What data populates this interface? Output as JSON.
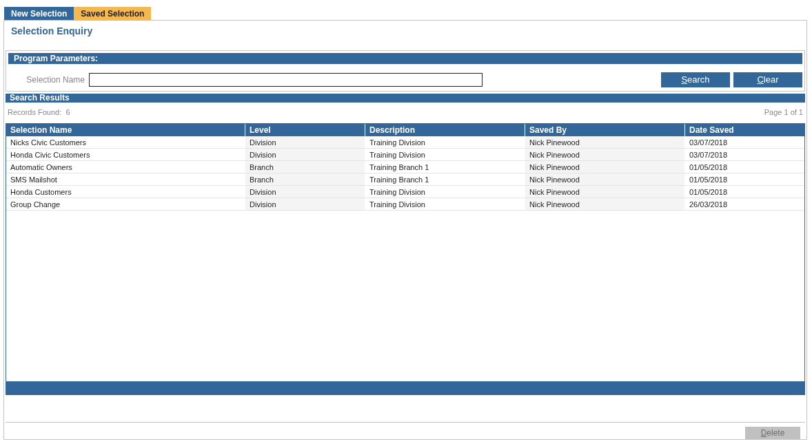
{
  "tabs": [
    {
      "label": "New Selection",
      "selected": false
    },
    {
      "label": "Saved Selection",
      "selected": true
    }
  ],
  "title": "Selection Enquiry",
  "parameters": {
    "heading": "Program Parameters:",
    "field_label": "Selection Name",
    "buttons": [
      {
        "label": "Search",
        "disabled": false
      },
      {
        "label": "Clear",
        "disabled": false
      }
    ]
  },
  "results": {
    "heading": "Search Results",
    "records_label": "Records Found:",
    "records_count": "6",
    "page": "Page 1 of 1"
  },
  "table": {
    "columns": [
      "Selection Name",
      "Level",
      "Description",
      "Saved By",
      "Date Saved"
    ],
    "rows": [
      [
        "Nicks Civic Customers",
        "Division",
        "Training Division",
        "Nick Pinewood",
        "03/07/2018"
      ],
      [
        "Honda Civic Customers",
        "Division",
        "Training Division",
        "Nick Pinewood",
        "03/07/2018"
      ],
      [
        "Automatic Owners",
        "Branch",
        "Training Branch 1",
        "Nick Pinewood",
        "01/05/2018"
      ],
      [
        "SMS Mailshot",
        "Branch",
        "Training Branch 1",
        "Nick Pinewood",
        "01/05/2018"
      ],
      [
        "Honda Customers",
        "Division",
        "Training Division",
        "Nick Pinewood",
        "01/05/2018"
      ],
      [
        "Group Change",
        "Division",
        "Training Division",
        "Nick Pinewood",
        "26/03/2018"
      ]
    ]
  },
  "footer_buttons": [
    {
      "label": "Delete",
      "disabled": true
    }
  ]
}
